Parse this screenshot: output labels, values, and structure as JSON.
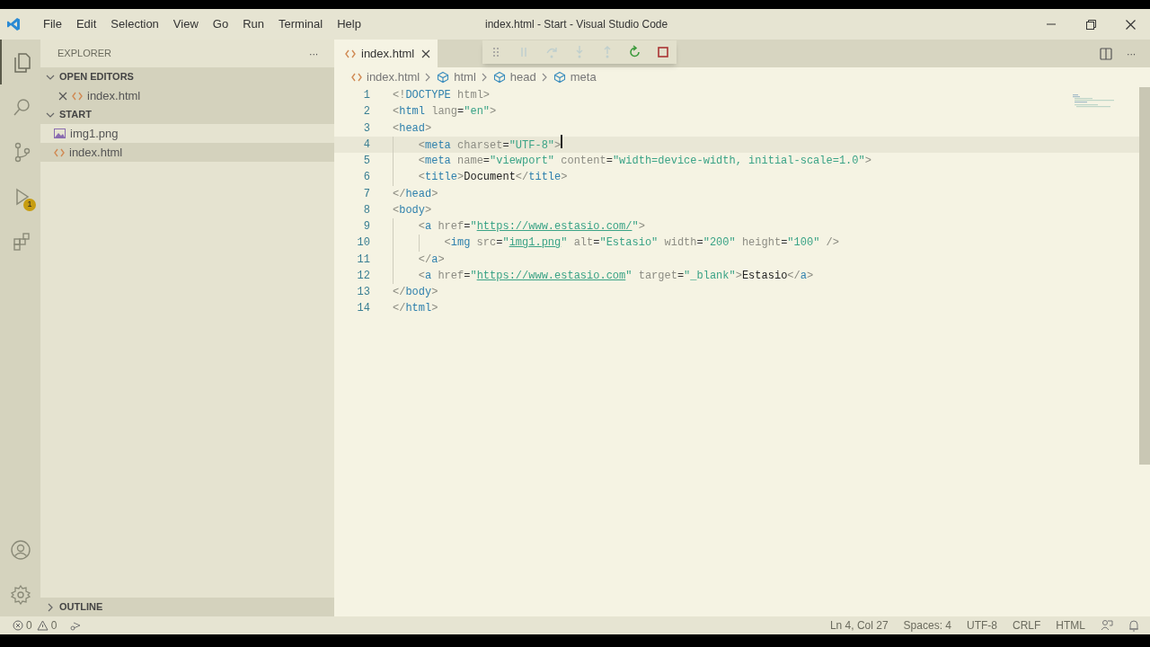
{
  "menu": [
    "File",
    "Edit",
    "Selection",
    "View",
    "Go",
    "Run",
    "Terminal",
    "Help"
  ],
  "window": {
    "title": "index.html - Start - Visual Studio Code"
  },
  "activity_bar": {
    "items": [
      {
        "kind": "files",
        "selected": true
      },
      {
        "kind": "search",
        "selected": false
      },
      {
        "kind": "branch",
        "selected": false
      },
      {
        "kind": "debug",
        "selected": false,
        "badge": "1"
      },
      {
        "kind": "extensions",
        "selected": false
      }
    ],
    "bottom": [
      {
        "kind": "account"
      },
      {
        "kind": "settings"
      }
    ]
  },
  "sidebar": {
    "title": "EXPLORER",
    "more": "···",
    "open_editors": {
      "title": "OPEN EDITORS",
      "expanded": true,
      "items": [
        {
          "name": "index.html",
          "kind": "html",
          "selected": true
        }
      ]
    },
    "folder": {
      "title": "START",
      "expanded": true,
      "items": [
        {
          "name": "img1.png",
          "kind": "image",
          "selected": false
        },
        {
          "name": "index.html",
          "kind": "html",
          "selected": true
        }
      ]
    },
    "outline": {
      "title": "OUTLINE",
      "expanded": false
    }
  },
  "tabs": [
    {
      "label": "index.html",
      "selected": true
    }
  ],
  "breadcrumbs": [
    {
      "label": "index.html",
      "kind": "file"
    },
    {
      "label": "html",
      "kind": "element"
    },
    {
      "label": "head",
      "kind": "element"
    },
    {
      "label": "meta",
      "kind": "element"
    }
  ],
  "code": [
    {
      "number": "1",
      "current": false,
      "tokens": [
        {
          "kind": "punct",
          "text": "<!"
        },
        {
          "kind": "tag",
          "text": "DOCTYPE"
        },
        {
          "kind": "attr",
          "text": " html"
        },
        {
          "kind": "punct",
          "text": ">"
        }
      ]
    },
    {
      "number": "2",
      "current": false,
      "tokens": [
        {
          "kind": "punct",
          "text": "<"
        },
        {
          "kind": "tag",
          "text": "html"
        },
        {
          "kind": "attr",
          "text": " lang"
        },
        {
          "kind": "eq",
          "text": "="
        },
        {
          "kind": "string",
          "text": "\"en\""
        },
        {
          "kind": "punct",
          "text": ">"
        }
      ]
    },
    {
      "number": "3",
      "current": false,
      "tokens": [
        {
          "kind": "punct",
          "text": "<"
        },
        {
          "kind": "tag",
          "text": "head"
        },
        {
          "kind": "punct",
          "text": ">"
        }
      ]
    },
    {
      "number": "4",
      "current": true,
      "tokens": [
        {
          "kind": "punct",
          "text": "    <"
        },
        {
          "kind": "tag",
          "text": "meta"
        },
        {
          "kind": "attr",
          "text": " charset"
        },
        {
          "kind": "eq",
          "text": "="
        },
        {
          "kind": "string",
          "text": "\"UTF-8\""
        },
        {
          "kind": "punct",
          "text": ">"
        }
      ]
    },
    {
      "number": "5",
      "current": false,
      "tokens": [
        {
          "kind": "punct",
          "text": "    <"
        },
        {
          "kind": "tag",
          "text": "meta"
        },
        {
          "kind": "attr",
          "text": " name"
        },
        {
          "kind": "eq",
          "text": "="
        },
        {
          "kind": "string",
          "text": "\"viewport\""
        },
        {
          "kind": "attr",
          "text": " content"
        },
        {
          "kind": "eq",
          "text": "="
        },
        {
          "kind": "string",
          "text": "\"width=device-width, initial-scale=1.0\""
        },
        {
          "kind": "punct",
          "text": ">"
        }
      ]
    },
    {
      "number": "6",
      "current": false,
      "tokens": [
        {
          "kind": "punct",
          "text": "    <"
        },
        {
          "kind": "tag",
          "text": "title"
        },
        {
          "kind": "punct",
          "text": ">"
        },
        {
          "kind": "text",
          "text": "Document"
        },
        {
          "kind": "punct",
          "text": "</"
        },
        {
          "kind": "tag",
          "text": "title"
        },
        {
          "kind": "punct",
          "text": ">"
        }
      ]
    },
    {
      "number": "7",
      "current": false,
      "tokens": [
        {
          "kind": "punct",
          "text": "</"
        },
        {
          "kind": "tag",
          "text": "head"
        },
        {
          "kind": "punct",
          "text": ">"
        }
      ]
    },
    {
      "number": "8",
      "current": false,
      "tokens": [
        {
          "kind": "punct",
          "text": "<"
        },
        {
          "kind": "tag",
          "text": "body"
        },
        {
          "kind": "punct",
          "text": ">"
        }
      ]
    },
    {
      "number": "9",
      "current": false,
      "tokens": [
        {
          "kind": "punct",
          "text": "    <"
        },
        {
          "kind": "tag",
          "text": "a"
        },
        {
          "kind": "attr",
          "text": " href"
        },
        {
          "kind": "eq",
          "text": "="
        },
        {
          "kind": "string",
          "text": "\""
        },
        {
          "kind": "link",
          "text": "https://www.estasio.com/"
        },
        {
          "kind": "string",
          "text": "\""
        },
        {
          "kind": "punct",
          "text": ">"
        }
      ]
    },
    {
      "number": "10",
      "current": false,
      "tokens": [
        {
          "kind": "punct",
          "text": "        <"
        },
        {
          "kind": "tag",
          "text": "img"
        },
        {
          "kind": "attr",
          "text": " src"
        },
        {
          "kind": "eq",
          "text": "="
        },
        {
          "kind": "string",
          "text": "\""
        },
        {
          "kind": "link",
          "text": "img1.png"
        },
        {
          "kind": "string",
          "text": "\""
        },
        {
          "kind": "attr",
          "text": " alt"
        },
        {
          "kind": "eq",
          "text": "="
        },
        {
          "kind": "string",
          "text": "\"Estasio\""
        },
        {
          "kind": "attr",
          "text": " width"
        },
        {
          "kind": "eq",
          "text": "="
        },
        {
          "kind": "string",
          "text": "\"200\""
        },
        {
          "kind": "attr",
          "text": " height"
        },
        {
          "kind": "eq",
          "text": "="
        },
        {
          "kind": "string",
          "text": "\"100\""
        },
        {
          "kind": "punct",
          "text": " />"
        }
      ]
    },
    {
      "number": "11",
      "current": false,
      "tokens": [
        {
          "kind": "punct",
          "text": "    </"
        },
        {
          "kind": "tag",
          "text": "a"
        },
        {
          "kind": "punct",
          "text": ">"
        }
      ]
    },
    {
      "number": "12",
      "current": false,
      "tokens": [
        {
          "kind": "punct",
          "text": "    <"
        },
        {
          "kind": "tag",
          "text": "a"
        },
        {
          "kind": "attr",
          "text": " href"
        },
        {
          "kind": "eq",
          "text": "="
        },
        {
          "kind": "string",
          "text": "\""
        },
        {
          "kind": "link",
          "text": "https://www.estasio.com"
        },
        {
          "kind": "string",
          "text": "\""
        },
        {
          "kind": "attr",
          "text": " target"
        },
        {
          "kind": "eq",
          "text": "="
        },
        {
          "kind": "string",
          "text": "\"_blank\""
        },
        {
          "kind": "punct",
          "text": ">"
        },
        {
          "kind": "text",
          "text": "Estasio"
        },
        {
          "kind": "punct",
          "text": "</"
        },
        {
          "kind": "tag",
          "text": "a"
        },
        {
          "kind": "punct",
          "text": ">"
        }
      ]
    },
    {
      "number": "13",
      "current": false,
      "tokens": [
        {
          "kind": "punct",
          "text": "</"
        },
        {
          "kind": "tag",
          "text": "body"
        },
        {
          "kind": "punct",
          "text": ">"
        }
      ]
    },
    {
      "number": "14",
      "current": false,
      "tokens": [
        {
          "kind": "punct",
          "text": "</"
        },
        {
          "kind": "tag",
          "text": "html"
        },
        {
          "kind": "punct",
          "text": ">"
        }
      ]
    }
  ],
  "debug_toolbar": [
    {
      "kind": "grip",
      "disabled": false
    },
    {
      "kind": "pause",
      "disabled": true
    },
    {
      "kind": "step_over",
      "disabled": true
    },
    {
      "kind": "step_into",
      "disabled": true
    },
    {
      "kind": "step_out",
      "disabled": true
    },
    {
      "kind": "restart",
      "disabled": false
    },
    {
      "kind": "stop",
      "disabled": false
    }
  ],
  "status_bar": {
    "errors": "0",
    "warnings": "0",
    "right": [
      "Ln 4, Col 27",
      "Spaces: 4",
      "UTF-8",
      "CRLF",
      "HTML"
    ]
  }
}
